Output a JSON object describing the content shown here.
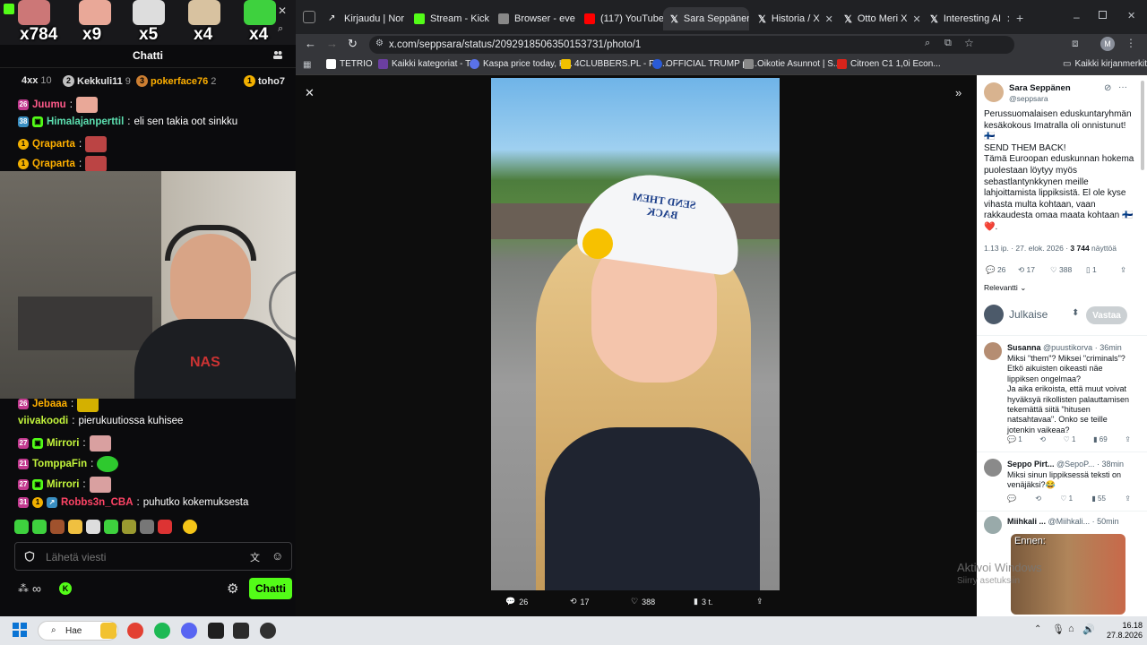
{
  "chat_window": {
    "url_fragment": "popout",
    "title": "Chatti",
    "emote_counts": [
      "x784",
      "x9",
      "x5",
      "x4",
      "x4"
    ],
    "leaderboard": [
      {
        "rank": "",
        "name": "4xx",
        "count": "10"
      },
      {
        "rank": "2",
        "name": "Kekkuli11",
        "count": "9"
      },
      {
        "rank": "3",
        "name": "pokerface76",
        "count": "2"
      },
      {
        "rank": "1",
        "name": "toho7",
        "count": ""
      }
    ],
    "messages": [
      {
        "badge": "26",
        "nick": "Juumu",
        "sep": ":",
        "text": "",
        "nick_color": "#ff5a8a"
      },
      {
        "badge": "38",
        "nick": "Himalajanperttil",
        "sep": ":",
        "text": "eli sen takia oot sinkku",
        "nick_color": "#5ce0b0"
      },
      {
        "badge": "1",
        "nick": "Qraparta",
        "sep": ":",
        "text": "",
        "nick_color": "#ffb000"
      },
      {
        "badge": "1",
        "nick": "Qraparta",
        "sep": ":",
        "text": "",
        "nick_color": "#ffb000"
      },
      {
        "badge": "26",
        "nick": "Jebaaa",
        "sep": ":",
        "text": "",
        "nick_color": "#ffb000"
      },
      {
        "badge": "",
        "nick": "viivakoodi",
        "sep": ":",
        "text": "pierukuutiossa kuhisee",
        "nick_color": "#c3f53c"
      },
      {
        "badge": "27",
        "nick": "Mirrori",
        "sep": ":",
        "text": "",
        "nick_color": "#c3f53c"
      },
      {
        "badge": "21",
        "nick": "TomppaFin",
        "sep": ":",
        "text": "",
        "nick_color": "#c3f53c"
      },
      {
        "badge": "27",
        "nick": "Mirrori",
        "sep": ":",
        "text": "",
        "nick_color": "#c3f53c"
      },
      {
        "badge": "31",
        "nick": "Robbs3n_CBA",
        "sep": ":",
        "text": "puhutko kokemuksesta",
        "nick_color": "#ff4466"
      }
    ],
    "input_placeholder": "Lähetä viesti",
    "send_label": "Chatti"
  },
  "browser": {
    "tabs": [
      {
        "label": "Kirjaudu | Nor",
        "color": "#ffffff"
      },
      {
        "label": "Stream - Kick",
        "color": "#53fc18"
      },
      {
        "label": "Browser - eve",
        "color": "#888888"
      },
      {
        "label": "(117) YouTube",
        "color": "#ff0000"
      },
      {
        "label": "Sara Seppänen",
        "color": "#ffffff",
        "active": true
      },
      {
        "label": "Historia / X",
        "color": "#ffffff"
      },
      {
        "label": "Otto Meri X",
        "color": "#ffffff"
      },
      {
        "label": "Interesting AI",
        "color": "#ffffff"
      }
    ],
    "url": "x.com/seppsara/status/2092918506350153731/photo/1",
    "profile_initial": "M",
    "bookmarks": [
      {
        "label": "TETRIO",
        "color": "#ffffff"
      },
      {
        "label": "Kaikki kategoriat - T...",
        "color": "#6b3fa0"
      },
      {
        "label": "Kaspa price today, K...",
        "color": "#5a72e8"
      },
      {
        "label": "4CLUBBERS.PL - Po...",
        "color": "#f0c000"
      },
      {
        "label": "OFFICIAL TRUMP pr...",
        "color": "#2a5bd7"
      },
      {
        "label": "Oikotie Asunnot | S...",
        "color": "#888888"
      },
      {
        "label": "Citroen C1 1,0i Econ...",
        "color": "#d9241b"
      }
    ],
    "bookmarks_folder": "Kaikki kirjanmerkit"
  },
  "photo": {
    "cap_text_line1": "SEND THEM",
    "cap_text_line2": "BACK",
    "actions": {
      "replies": "26",
      "reposts": "17",
      "likes": "388",
      "views": "3 t."
    }
  },
  "post": {
    "author_name": "Sara Seppänen",
    "author_handle": "@seppsara",
    "body_lines": [
      "Perussuomalaisen eduskuntaryhmän kesäkokous Imatralla oli onnistunut!",
      "🇫🇮",
      "SEND THEM BACK!",
      "Tämä Euroopan eduskunnan hokema puolestaan löytyy myös sebastlantynkkynen meille lahjoittamista lippiksistä. El ole kyse vihasta multa kohtaan, vaan rakkaudesta omaa maata kohtaan 🇫🇮 ❤️."
    ],
    "meta_prefix": "1.13 ip. · 27. elok. 2026 · ",
    "meta_views": "3 744",
    "meta_suffix": " näyttöä",
    "stats": {
      "replies": "26",
      "reposts": "17",
      "likes": "388",
      "bookmarks": "1"
    },
    "sort_label": "Relevantti",
    "reply_placeholder": "Julkaise",
    "reply_button": "Vastaa"
  },
  "replies": [
    {
      "name": "Susanna",
      "handle": "@puustikorva · 36min",
      "text": "Miksi \"them\"? Miksei \"criminals\"? Etkö aikuisten oikeasti näe lippiksen ongelmaa?\nJa aika erikoista, että muut voivat hyväksyä rikollisten palauttamisen tekemättä siitä \"hitusen natsahtavaa\". Onko se teille jotenkin vaikeaa?",
      "stats": {
        "replies": "1",
        "reposts": "",
        "likes": "1",
        "views": "69"
      }
    },
    {
      "name": "Seppo Pirt...",
      "handle": "@SepoP... · 38min",
      "text": "Miksi sinun lippiksessä teksti on venäjäksi?😂",
      "stats": {
        "replies": "",
        "reposts": "",
        "likes": "1",
        "views": "55"
      }
    },
    {
      "name": "Miihkali ...",
      "handle": "@Miihkali... · 50min",
      "image_label": "Ennen:"
    }
  ],
  "watermark": {
    "line1": "Aktivoi Windows",
    "line2": "Siirry asetuksiin"
  },
  "taskbar": {
    "search": "Hae",
    "time": "16.18",
    "date": "27.8.2026"
  }
}
